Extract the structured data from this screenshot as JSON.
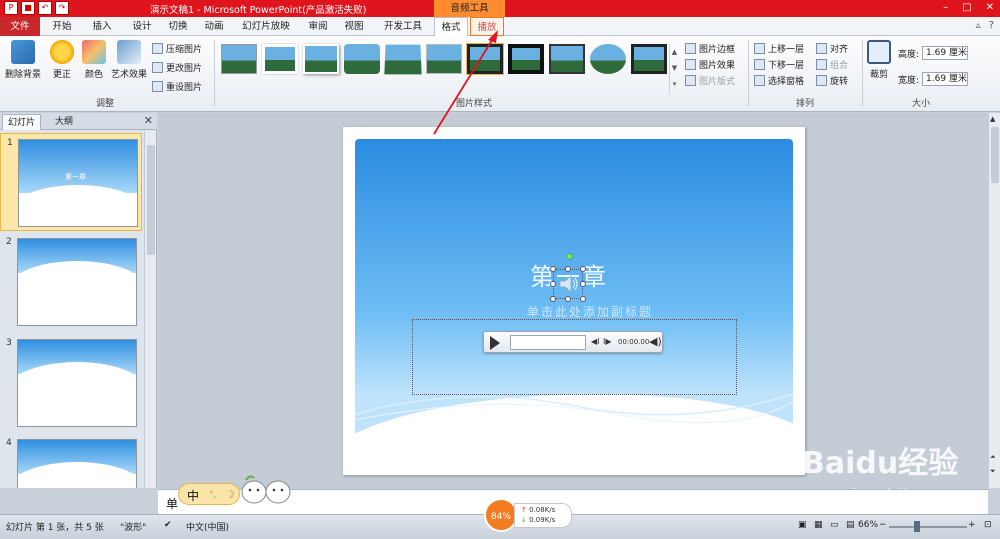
{
  "titlebar": {
    "title": "演示文稿1 - Microsoft PowerPoint(产品激活失败)",
    "context_tab": "音频工具",
    "colors": {
      "bar": "#e0141c",
      "context": "#ff8d30"
    }
  },
  "tabs": [
    "文件",
    "开始",
    "插入",
    "设计",
    "切换",
    "动画",
    "幻灯片放映",
    "审阅",
    "视图",
    "开发工具",
    "格式",
    "播放"
  ],
  "ribbon": {
    "adjust": {
      "remove_bg": "删除背景",
      "correct": "更正",
      "color": "颜色",
      "art_effect": "艺术效果",
      "compress": "压缩图片",
      "change": "更改图片",
      "reset": "重设图片",
      "label": "调整"
    },
    "picture_styles": {
      "label": "图片样式",
      "border": "图片边框",
      "effect": "图片效果",
      "layout": "图片版式"
    },
    "arrange": {
      "label": "排列",
      "bring_forward": "上移一层",
      "send_backward": "下移一层",
      "selection_pane": "选择窗格",
      "align": "对齐",
      "group": "组合",
      "rotate": "旋转"
    },
    "size": {
      "label": "大小",
      "crop": "裁剪",
      "height_label": "高度:",
      "height_value": "1.69 厘米",
      "width_label": "宽度:",
      "width_value": "1.69 厘米"
    }
  },
  "left_pane": {
    "tab_slides": "幻灯片",
    "tab_outline": "大纲",
    "slides": [
      {
        "num": "1",
        "title": "第一章"
      },
      {
        "num": "2"
      },
      {
        "num": "3"
      },
      {
        "num": "4"
      }
    ]
  },
  "slide": {
    "title": "第一章",
    "subtitle": "单击此处添加副标题",
    "player_time": "00:00.00"
  },
  "notes": {
    "text": "单"
  },
  "ime": {
    "char": "中"
  },
  "statusbar": {
    "slide_info": "幻灯片 第 1 张，共 5 张",
    "theme": "\"波形\"",
    "language": "中文(中国)",
    "zoom": "66%",
    "speed_percent": "84%",
    "upload": "0.08K/s",
    "download": "0.09K/s"
  },
  "watermark": {
    "brand": "Baidu经验",
    "url": "jingyan.baidu.com"
  }
}
